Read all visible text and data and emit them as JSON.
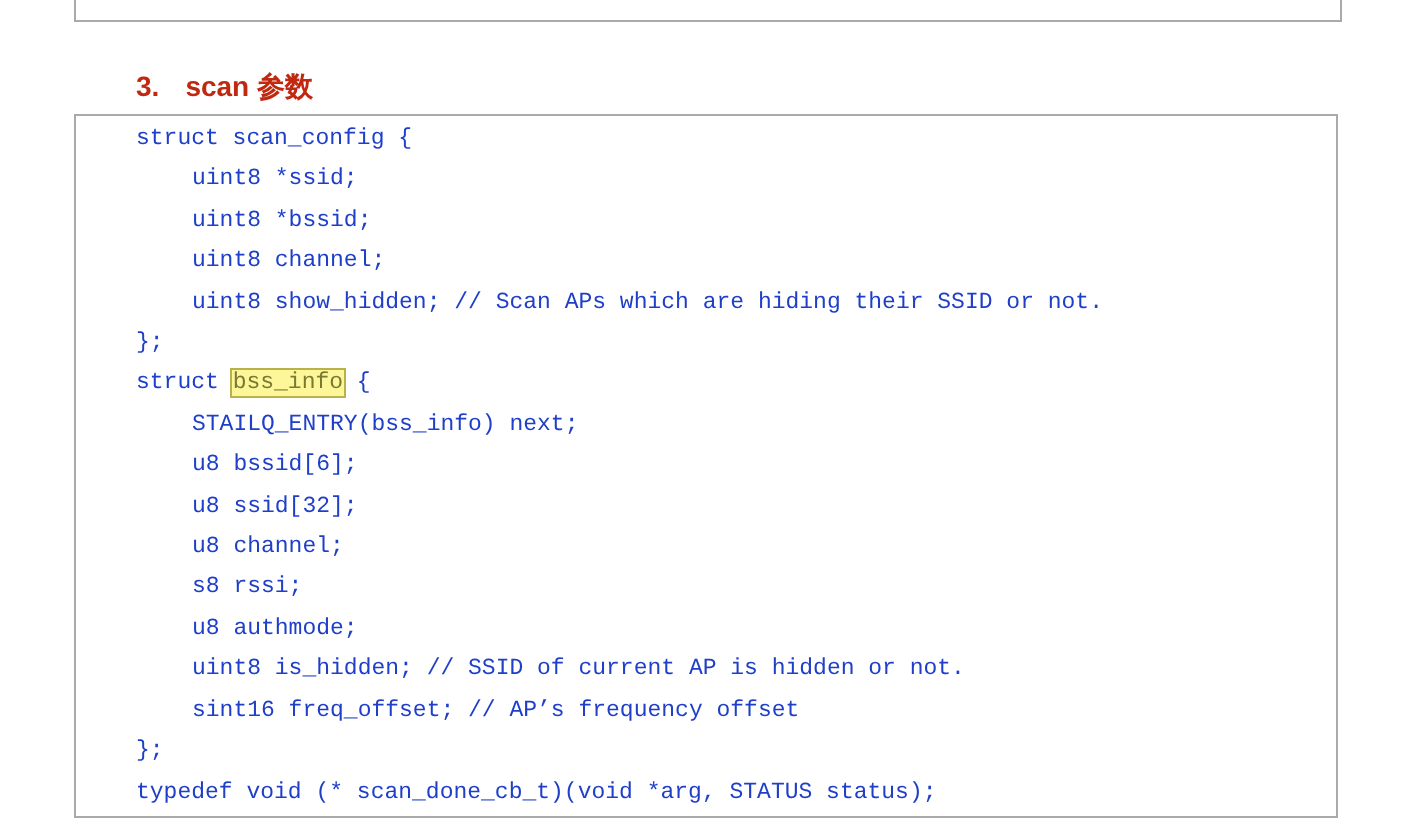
{
  "section_heading": {
    "number": "3.",
    "title": "scan 参数"
  },
  "code_lines": [
    {
      "segments": [
        {
          "text": "struct scan_config {",
          "highlighted": false
        }
      ],
      "children": [
        {
          "segments": [
            {
              "text": "uint8 *ssid;",
              "highlighted": false
            }
          ]
        },
        {
          "segments": [
            {
              "text": "uint8 *bssid;",
              "highlighted": false
            }
          ]
        },
        {
          "segments": [
            {
              "text": "uint8 channel;",
              "highlighted": false
            }
          ]
        },
        {
          "segments": [
            {
              "text": "uint8 show_hidden; // Scan APs which are hiding their SSID or not.",
              "highlighted": false
            }
          ]
        }
      ]
    },
    {
      "segments": [
        {
          "text": "};",
          "highlighted": false
        }
      ]
    },
    {
      "segments": [
        {
          "text": "struct ",
          "highlighted": false
        },
        {
          "text": "bss_info",
          "highlighted": true
        },
        {
          "text": " {",
          "highlighted": false
        }
      ],
      "children": [
        {
          "segments": [
            {
              "text": "STAILQ_ENTRY(bss_info) next;",
              "highlighted": false
            }
          ]
        },
        {
          "segments": [
            {
              "text": "u8 bssid[6];",
              "highlighted": false
            }
          ]
        },
        {
          "segments": [
            {
              "text": "u8 ssid[32];",
              "highlighted": false
            }
          ]
        },
        {
          "segments": [
            {
              "text": "u8 channel;",
              "highlighted": false
            }
          ]
        },
        {
          "segments": [
            {
              "text": "s8 rssi;",
              "highlighted": false
            }
          ]
        },
        {
          "segments": [
            {
              "text": "u8 authmode;",
              "highlighted": false
            }
          ]
        },
        {
          "segments": [
            {
              "text": "uint8 is_hidden; // SSID of current AP is hidden or not.",
              "highlighted": false
            }
          ]
        },
        {
          "segments": [
            {
              "text": "sint16 freq_offset; // AP’s frequency offset",
              "highlighted": false
            }
          ]
        }
      ]
    },
    {
      "segments": [
        {
          "text": "};",
          "highlighted": false
        }
      ]
    },
    {
      "segments": [
        {
          "text": "typedef void (* scan_done_cb_t)(void *arg, STATUS status);",
          "highlighted": false
        }
      ]
    }
  ]
}
